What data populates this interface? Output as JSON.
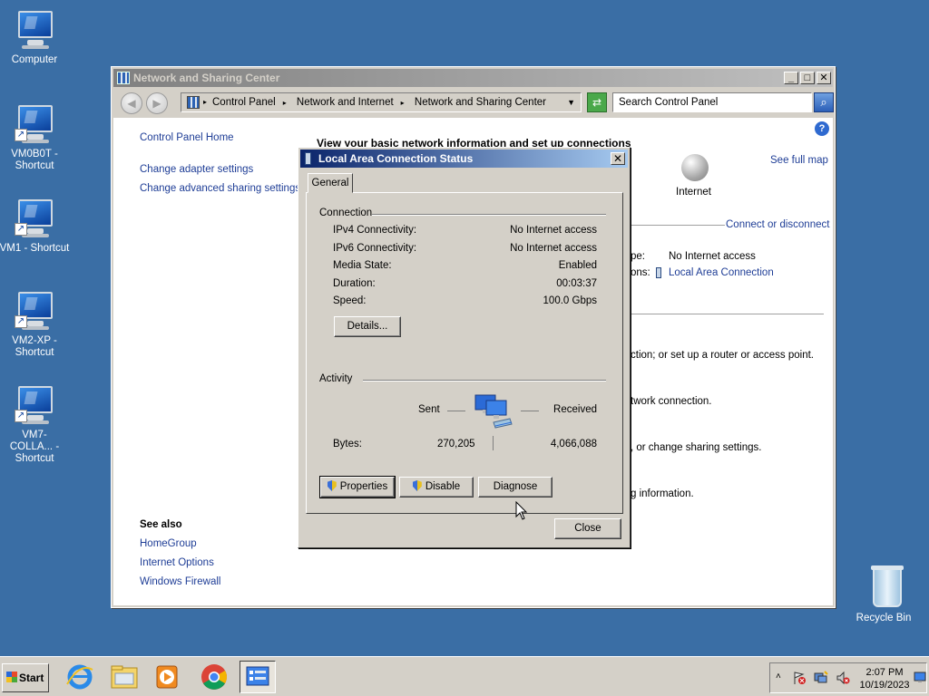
{
  "desktop": {
    "icons": [
      {
        "label": "Computer"
      },
      {
        "label": "VM0B0T - Shortcut"
      },
      {
        "label": "VM1 - Shortcut"
      },
      {
        "label": "VM2-XP - Shortcut"
      },
      {
        "label": "VM7-COLLA... - Shortcut"
      },
      {
        "label": "Recycle Bin"
      }
    ]
  },
  "window": {
    "title": "Network and Sharing Center",
    "breadcrumb": [
      "Control Panel",
      "Network and Internet",
      "Network and Sharing Center"
    ],
    "search_placeholder": "Search Control Panel",
    "sidebar": {
      "links": [
        "Control Panel Home",
        "Change adapter settings",
        "Change advanced sharing settings"
      ],
      "see_also_title": "See also",
      "see_also": [
        "HomeGroup",
        "Internet Options",
        "Windows Firewall"
      ]
    },
    "main": {
      "heading": "View your basic network information and set up connections",
      "see_full_map": "See full map",
      "internet_label": "Internet",
      "connect_or_disconnect": "Connect or disconnect",
      "access_type_partial": "pe:",
      "access_type_value": "No Internet access",
      "connections_partial": "ons:",
      "connection_link": "Local Area Connection",
      "task1_partial": "ction; or set up a router or access point.",
      "task2_partial": "twork connection.",
      "task3_partial": ", or change sharing settings.",
      "task4_partial": "g information."
    }
  },
  "dialog": {
    "title": "Local Area Connection Status",
    "tab": "General",
    "connection_group": "Connection",
    "rows": [
      {
        "label": "IPv4 Connectivity:",
        "value": "No Internet access"
      },
      {
        "label": "IPv6 Connectivity:",
        "value": "No Internet access"
      },
      {
        "label": "Media State:",
        "value": "Enabled"
      },
      {
        "label": "Duration:",
        "value": "00:03:37"
      },
      {
        "label": "Speed:",
        "value": "100.0 Gbps"
      }
    ],
    "details_button": "Details...",
    "activity_group": "Activity",
    "sent_label": "Sent",
    "received_label": "Received",
    "bytes_label": "Bytes:",
    "bytes_sent": "270,205",
    "bytes_received": "4,066,088",
    "properties_button": "Properties",
    "disable_button": "Disable",
    "diagnose_button": "Diagnose",
    "close_button": "Close"
  },
  "taskbar": {
    "start_label": "Start",
    "apps": [
      "internet-explorer-icon",
      "file-explorer-icon",
      "media-player-icon",
      "chrome-icon",
      "control-panel-icon"
    ],
    "clock_time": "2:07 PM",
    "clock_date": "10/19/2023"
  },
  "colors": {
    "desktop": "#3a6ea5",
    "dialog_title": "#0a246a",
    "link": "#1e3d96"
  }
}
